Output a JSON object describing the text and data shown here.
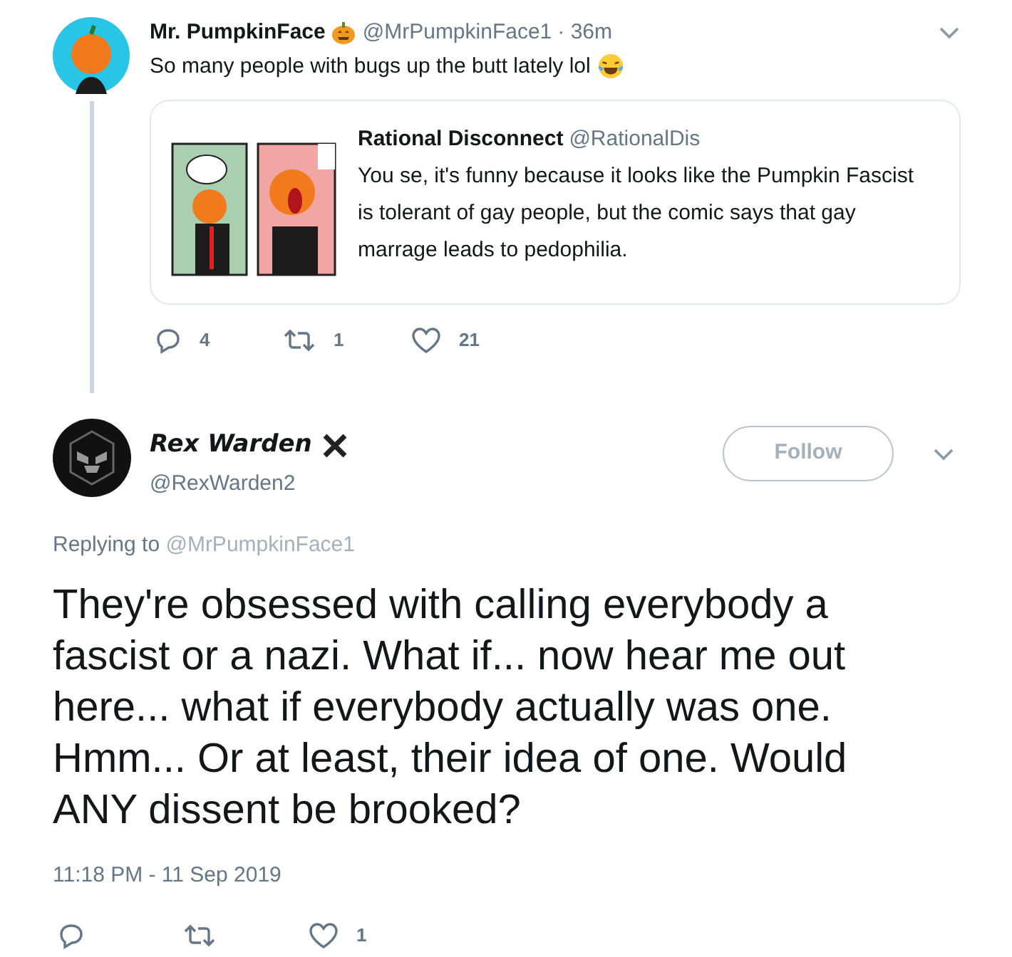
{
  "parent_tweet": {
    "name": "Mr. PumpkinFace",
    "handle": "@MrPumpkinFace1",
    "time": "· 36m",
    "text": "So many people with bugs up the butt lately lol",
    "quote": {
      "name": "Rational Disconnect",
      "handle": "@RationalDis",
      "text": "You se, it's funny because it looks like the Pumpkin Fascist is tolerant of gay people, but the comic says that gay marrage leads to pedophilia."
    },
    "actions": {
      "replies": "4",
      "retweets": "1",
      "likes": "21"
    }
  },
  "tweet": {
    "name": "Rex Warden",
    "handle": "@RexWarden2",
    "follow_label": "Follow",
    "replying_label": "Replying to",
    "replying_to": "@MrPumpkinFace1",
    "text": "They're obsessed with calling everybody a fascist or a nazi. What if... now hear me out here... what if everybody actually was one. Hmm... Or at least, their idea of one. Would ANY dissent be brooked?",
    "timestamp": "11:18 PM - 11 Sep 2019",
    "actions": {
      "likes": "1"
    }
  }
}
